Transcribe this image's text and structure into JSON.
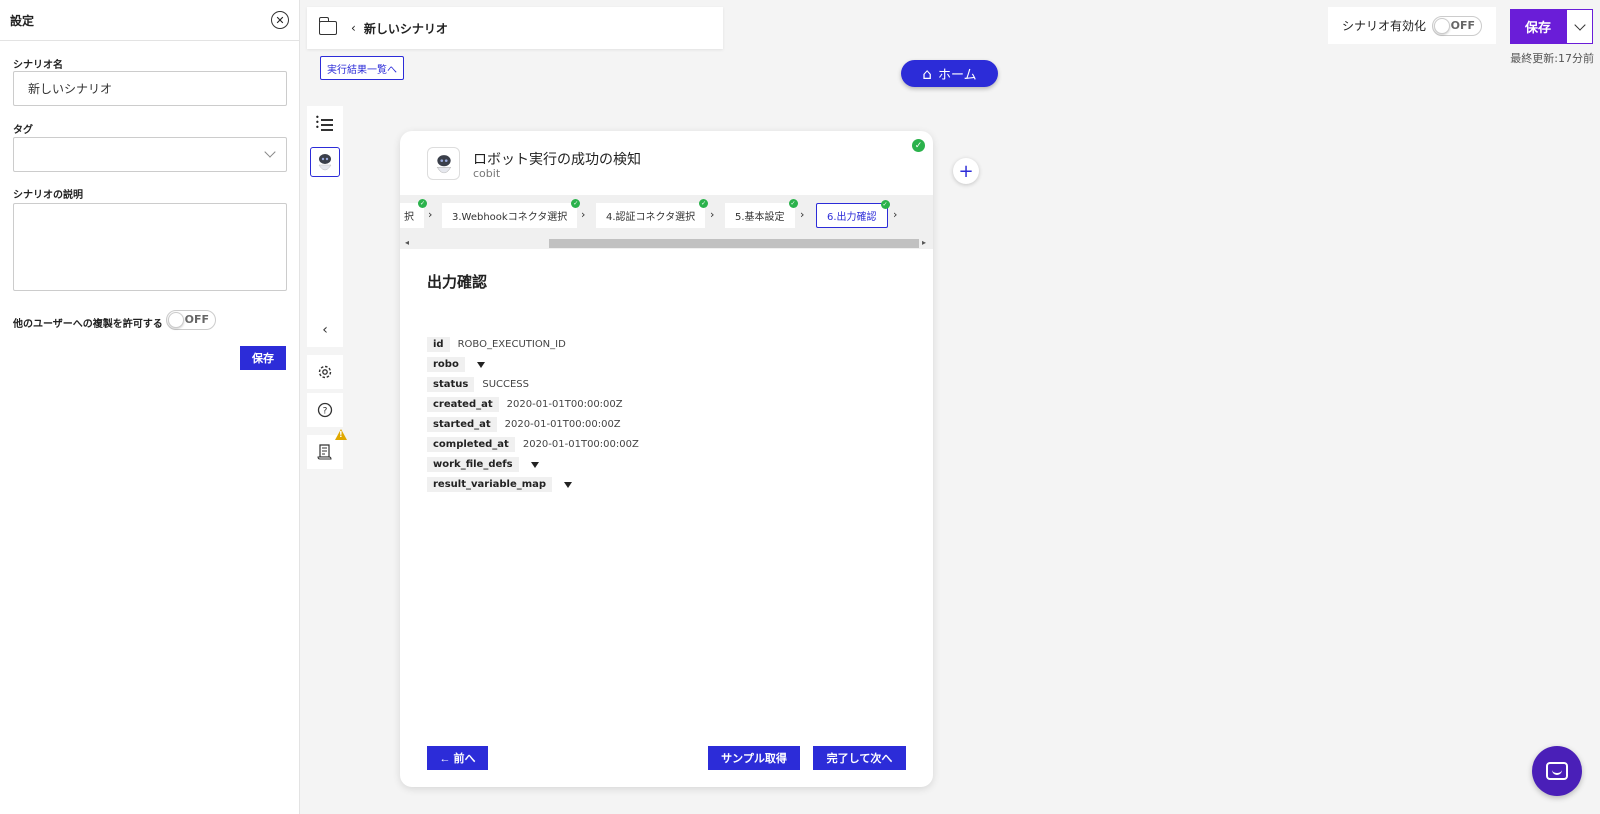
{
  "settings": {
    "title": "設定",
    "scenario_name_label": "シナリオ名",
    "scenario_name_value": "新しいシナリオ",
    "tag_label": "タグ",
    "description_label": "シナリオの説明",
    "allow_copy_label": "他のユーザーへの複製を許可する",
    "allow_copy_state": "OFF",
    "save_label": "保存"
  },
  "topbar": {
    "title": "新しいシナリオ"
  },
  "results_link": "実行結果一覧へ",
  "home_label": "ホーム",
  "enable": {
    "label": "シナリオ有効化",
    "state": "OFF"
  },
  "save_main_label": "保存",
  "last_updated": "最終更新:17分前",
  "card": {
    "title": "ロボット実行の成功の検知",
    "subtitle": "cobit",
    "steps": [
      "択",
      "3.Webhookコネクタ選択",
      "4.認証コネクタ選択",
      "5.基本設定",
      "6.出力確認"
    ],
    "output_heading": "出力確認",
    "fields": [
      {
        "key": "id",
        "value": "ROBO_EXECUTION_ID"
      },
      {
        "key": "robo",
        "value": ""
      },
      {
        "key": "status",
        "value": "SUCCESS"
      },
      {
        "key": "created_at",
        "value": "2020-01-01T00:00:00Z"
      },
      {
        "key": "started_at",
        "value": "2020-01-01T00:00:00Z"
      },
      {
        "key": "completed_at",
        "value": "2020-01-01T00:00:00Z"
      },
      {
        "key": "work_file_defs",
        "value": ""
      },
      {
        "key": "result_variable_map",
        "value": ""
      }
    ],
    "prev_label": "← 前へ",
    "sample_label": "サンプル取得",
    "next_label": "完了して次へ"
  },
  "colors": {
    "accent": "#2c2cd8",
    "save_purple": "#6a1dd8",
    "success": "#2bb24c",
    "warning": "#e0a800"
  }
}
